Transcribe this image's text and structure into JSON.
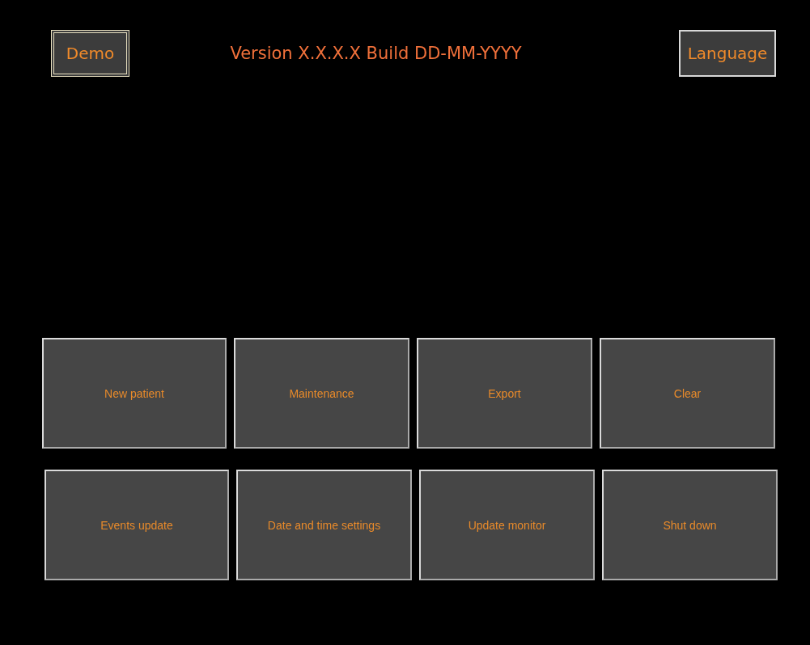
{
  "header": {
    "demo": {
      "label": "Demo",
      "on": true
    },
    "version": "Version X.X.X.X Build DD-MM-YYYY",
    "language": {
      "label": "Language"
    }
  },
  "menu_rows": [
    [
      "New patient",
      "Maintenance",
      "Export",
      "Clear"
    ],
    [
      "Events update",
      "Date and time settings",
      "Update monitor",
      "Shut down"
    ]
  ]
}
